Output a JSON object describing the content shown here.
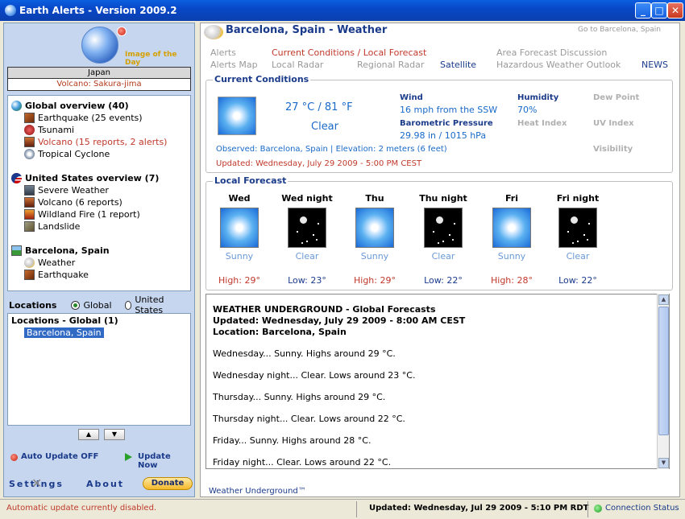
{
  "window": {
    "title": "Earth Alerts - Version 2009.2",
    "min": "_",
    "max": "□",
    "close": "✕"
  },
  "sidebar": {
    "image_of_day_label": "Image of the Day",
    "image_of_day_country": "Japan",
    "image_of_day_event": "Volcano: Sakura-jima",
    "groups": [
      {
        "label": "Global overview (40)",
        "icon": "globe-icon",
        "items": [
          {
            "label": "Earthquake (25 events)",
            "icon": "earthquake-icon"
          },
          {
            "label": "Tsunami",
            "icon": "tsunami-icon"
          },
          {
            "label": "Volcano (15 reports, 2 alerts)",
            "icon": "volcano-icon"
          },
          {
            "label": "Tropical Cyclone",
            "icon": "cyclone-icon"
          }
        ]
      },
      {
        "label": "United States overview (7)",
        "icon": "us-flag-icon",
        "items": [
          {
            "label": "Severe Weather",
            "icon": "severe-weather-icon"
          },
          {
            "label": "Volcano (6 reports)",
            "icon": "volcano-icon"
          },
          {
            "label": "Wildland Fire (1 report)",
            "icon": "fire-icon"
          },
          {
            "label": "Landslide",
            "icon": "landslide-icon"
          }
        ]
      },
      {
        "label": "Barcelona, Spain",
        "icon": "landscape-icon",
        "items": [
          {
            "label": "Weather",
            "icon": "weather-icon"
          },
          {
            "label": "Earthquake",
            "icon": "earthquake-icon"
          }
        ]
      }
    ],
    "locations_label": "Locations",
    "radio_global": "Global",
    "radio_us": "United States",
    "location_list_header": "Locations - Global (1)",
    "location_selected": "Barcelona, Spain",
    "move_up": "▲",
    "move_down": "▼",
    "auto_update": "Auto Update OFF",
    "update_now": "Update Now",
    "settings": "Settings",
    "about": "About",
    "donate": "Donate"
  },
  "main": {
    "title": "Barcelona, Spain - Weather",
    "goto": "Go to Barcelona, Spain",
    "nav": {
      "alerts": "Alerts",
      "alerts_map": "Alerts Map",
      "current_local": "Current Conditions / Local Forecast",
      "local_radar": "Local Radar",
      "regional_radar": "Regional Radar",
      "satellite": "Satellite",
      "area_discussion": "Area Forecast Discussion",
      "hazardous_outlook": "Hazardous Weather Outlook",
      "news": "NEWS"
    },
    "current": {
      "section_title": "Current Conditions",
      "temp": "27 °C / 81 °F",
      "condition": "Clear",
      "wind_label": "Wind",
      "wind_value": "16 mph from the SSW",
      "pressure_label": "Barometric Pressure",
      "pressure_value": "29.98 in / 1015 hPa",
      "humidity_label": "Humidity",
      "humidity_value": "70%",
      "dew_label": "Dew Point",
      "heat_label": "Heat Index",
      "uv_label": "UV Index",
      "visibility_label": "Visibility",
      "observed": "Observed: Barcelona, Spain | Elevation: 2 meters (6 feet)",
      "updated": "Updated: Wednesday, July 29 2009 - 5:00 PM CEST"
    },
    "forecast": {
      "section_title": "Local Forecast",
      "days": [
        {
          "name": "Wed",
          "cond": "Sunny",
          "temp": "High: 29°",
          "kind": "high",
          "icon": "sun"
        },
        {
          "name": "Wed night",
          "cond": "Clear",
          "temp": "Low: 23°",
          "kind": "low",
          "icon": "moon"
        },
        {
          "name": "Thu",
          "cond": "Sunny",
          "temp": "High: 29°",
          "kind": "high",
          "icon": "sun"
        },
        {
          "name": "Thu night",
          "cond": "Clear",
          "temp": "Low: 22°",
          "kind": "low",
          "icon": "moon"
        },
        {
          "name": "Fri",
          "cond": "Sunny",
          "temp": "High: 28°",
          "kind": "high",
          "icon": "sun"
        },
        {
          "name": "Fri night",
          "cond": "Clear",
          "temp": "Low: 22°",
          "kind": "low",
          "icon": "moon"
        }
      ]
    },
    "text_forecast": {
      "heading1": "WEATHER UNDERGROUND - Global Forecasts",
      "heading2": "Updated: Wednesday, July 29 2009 - 8:00 AM CEST",
      "heading3": "Location: Barcelona, Spain",
      "lines": [
        "Wednesday... Sunny. Highs around 29 °C.",
        "Wednesday night... Clear. Lows around 23 °C.",
        "Thursday... Sunny. Highs around 29 °C.",
        "Thursday night... Clear. Lows around 22 °C.",
        "Friday... Sunny. Highs around 28 °C.",
        "Friday night... Clear. Lows around 22 °C."
      ]
    },
    "source_link": "Weather Underground™"
  },
  "status": {
    "message": "Automatic update currently disabled.",
    "updated": "Updated: Wednesday, Jul 29 2009 - 5:10 PM RDT",
    "connection": "Connection Status"
  }
}
